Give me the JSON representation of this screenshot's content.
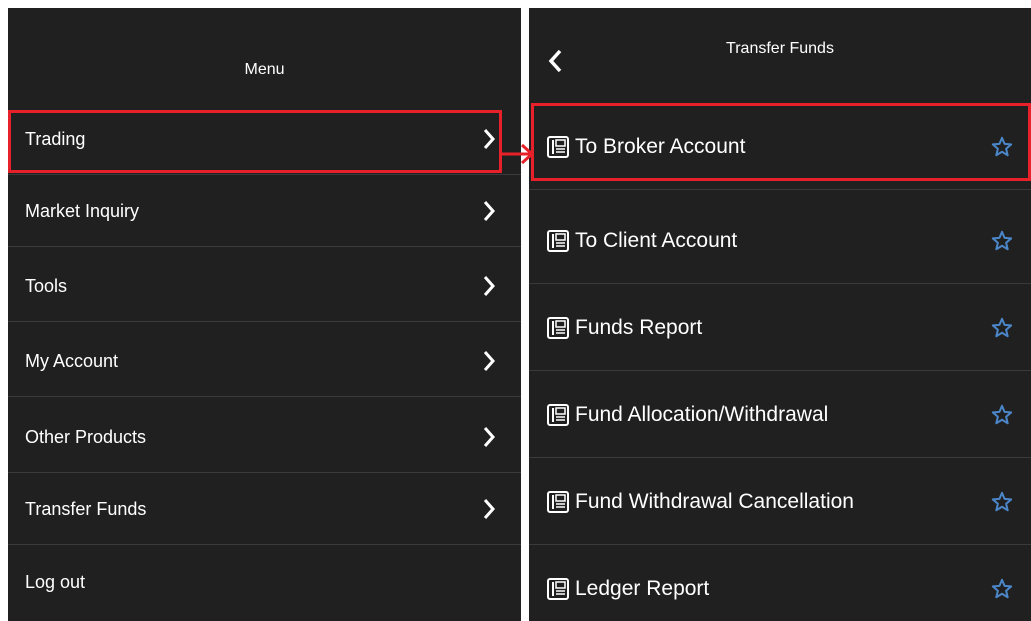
{
  "left_panel": {
    "title": "Menu",
    "items": [
      {
        "label": "Trading"
      },
      {
        "label": "Market Inquiry"
      },
      {
        "label": "Tools"
      },
      {
        "label": "My Account"
      },
      {
        "label": "Other Products"
      },
      {
        "label": "Transfer Funds"
      },
      {
        "label": "Log out"
      }
    ]
  },
  "right_panel": {
    "title": "Transfer Funds",
    "items": [
      {
        "label": "To Broker Account"
      },
      {
        "label": "To Client Account"
      },
      {
        "label": "Funds Report"
      },
      {
        "label": "Fund Allocation/Withdrawal"
      },
      {
        "label": "Fund Withdrawal Cancellation"
      },
      {
        "label": "Ledger Report"
      }
    ]
  },
  "colors": {
    "panel_bg": "#202020",
    "divider": "#3a3a3a",
    "highlight": "#e62129",
    "star": "#4a86c8"
  },
  "icons": [
    "back-chevron-icon",
    "chevron-right-icon",
    "document-icon",
    "star-icon",
    "arrow-right-icon"
  ]
}
